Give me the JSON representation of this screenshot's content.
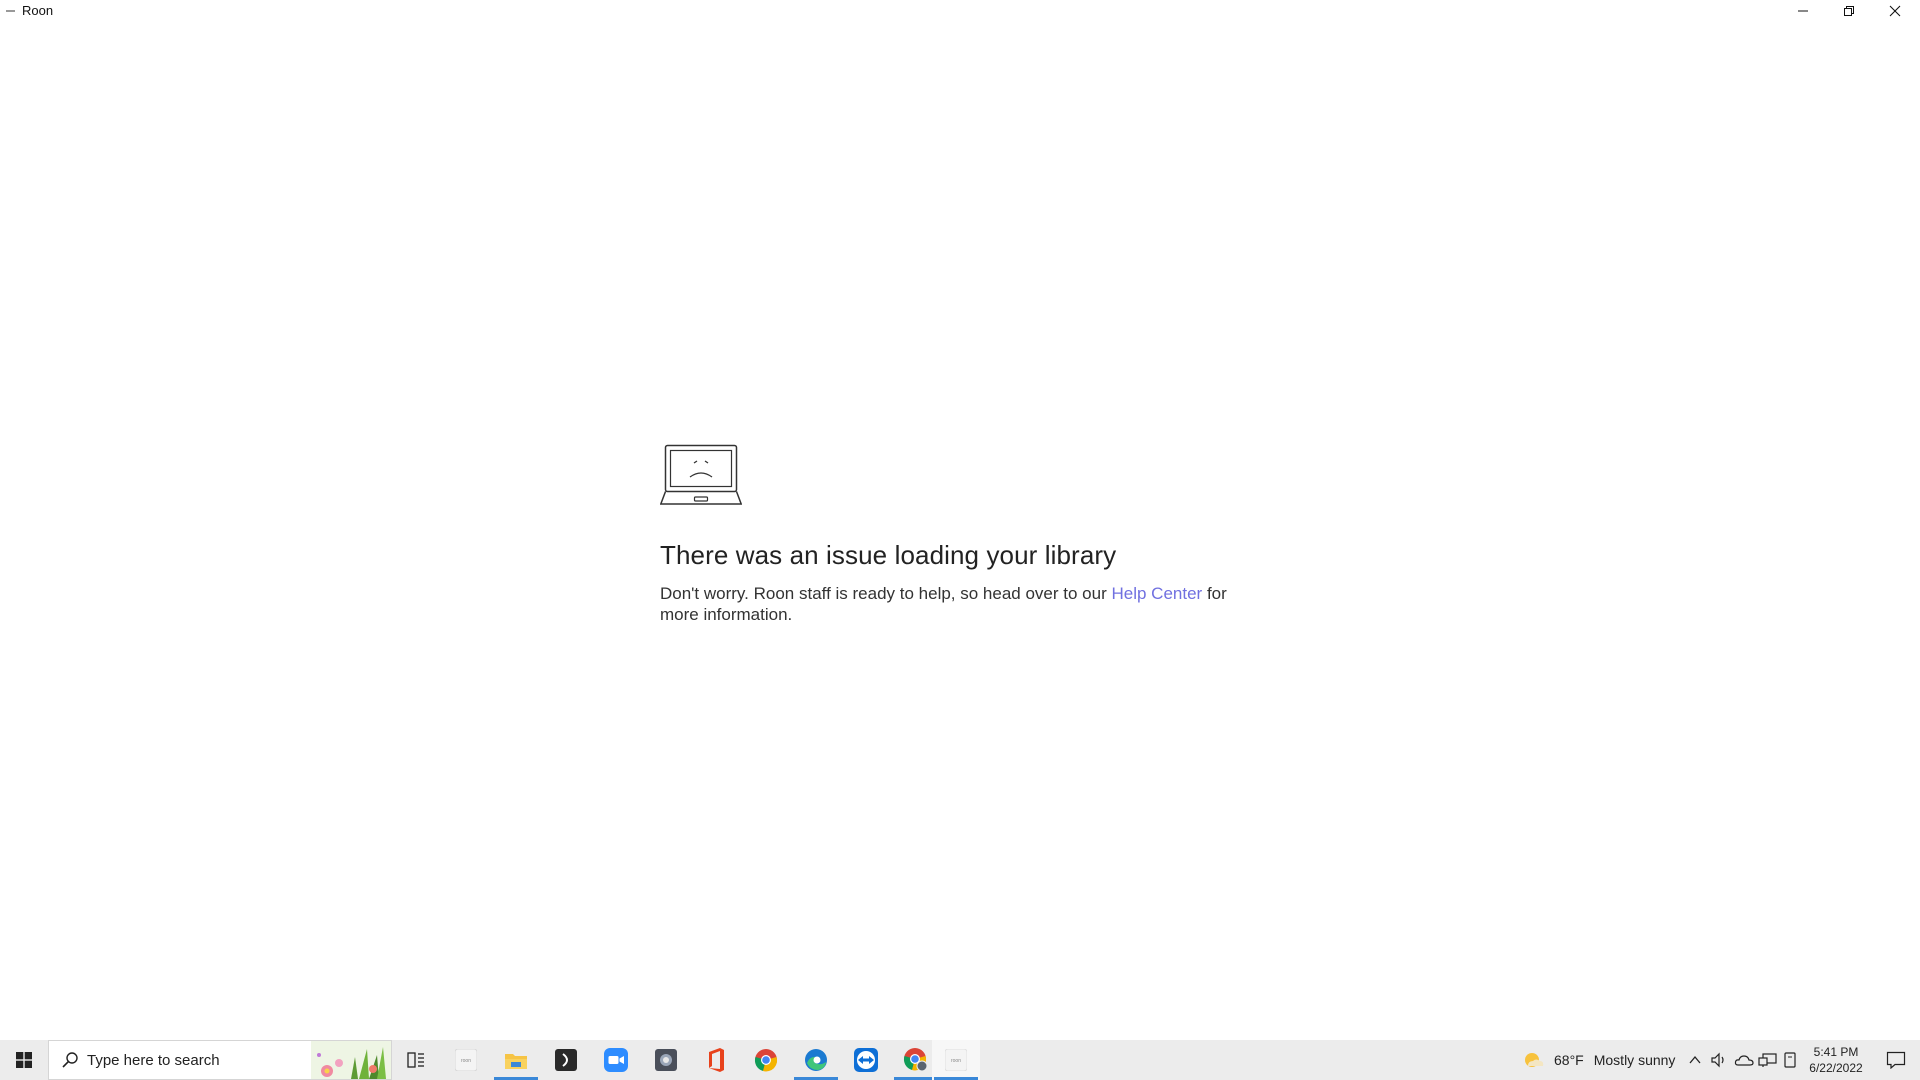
{
  "window": {
    "title": "Roon"
  },
  "error": {
    "title": "There was an issue loading your library",
    "body_before": "Don't worry. Roon staff is ready to help, so head over to our",
    "link_label": "Help Center",
    "body_after": "for more information."
  },
  "taskbar": {
    "search_placeholder": "Type here to search",
    "apps": [
      {
        "name": "task-view",
        "icon": "task-view-icon"
      },
      {
        "name": "roon",
        "icon": "roon-icon",
        "label": "roon"
      },
      {
        "name": "file-explorer",
        "icon": "folder-icon"
      },
      {
        "name": "app-dark",
        "icon": "app-icon"
      },
      {
        "name": "zoom",
        "icon": "zoom-icon"
      },
      {
        "name": "photo-app",
        "icon": "photo-app-icon"
      },
      {
        "name": "office",
        "icon": "office-icon"
      },
      {
        "name": "chrome",
        "icon": "chrome-icon"
      },
      {
        "name": "edge",
        "icon": "edge-icon"
      },
      {
        "name": "teamviewer",
        "icon": "teamviewer-icon"
      },
      {
        "name": "chrome-profile",
        "icon": "chrome-profile-icon"
      },
      {
        "name": "roon-active",
        "icon": "roon-icon",
        "label": "roon"
      }
    ],
    "weather": {
      "temp": "68°F",
      "desc": "Mostly sunny",
      "icon": "weather-sun-cloud-icon"
    },
    "clock": {
      "time": "5:41 PM",
      "date": "6/22/2022"
    },
    "colors": {
      "accent": "#3a88d8",
      "link": "#7070e0"
    }
  }
}
